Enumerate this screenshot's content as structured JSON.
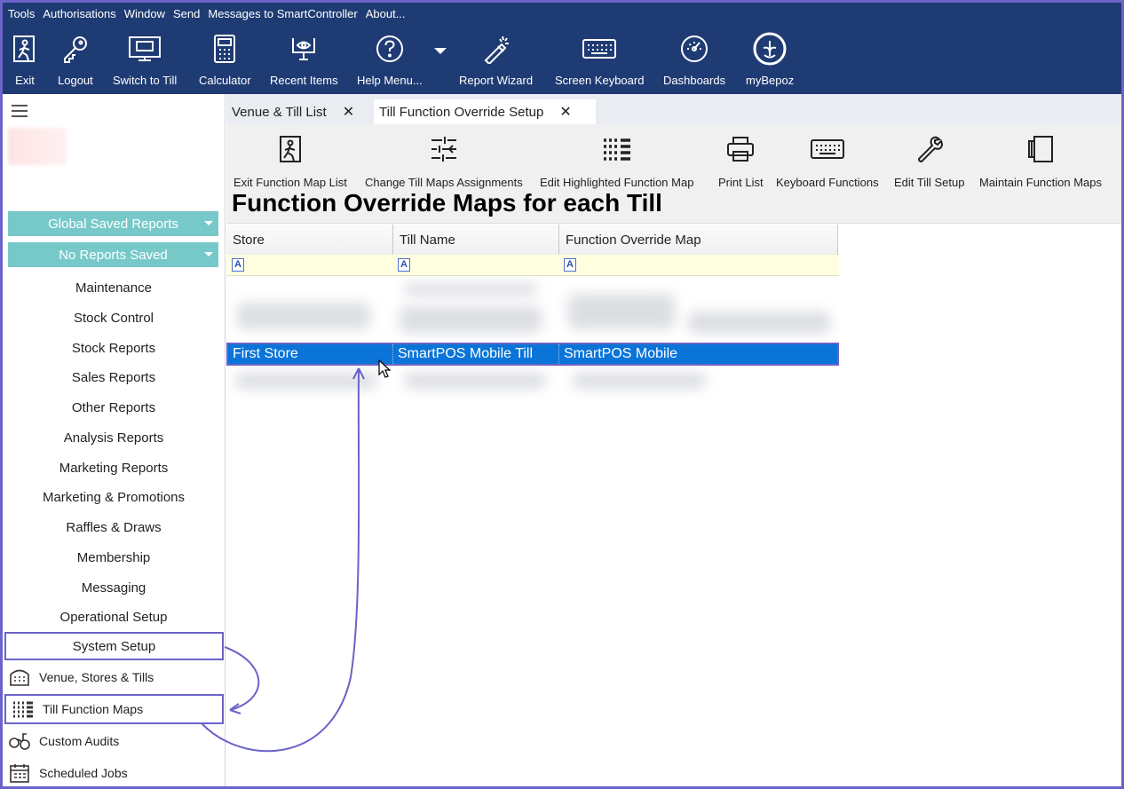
{
  "menubar": [
    "Tools",
    "Authorisations",
    "Window",
    "Send",
    "Messages to SmartController",
    "About..."
  ],
  "ribbon": [
    {
      "label": "Exit",
      "icon": "exit-icon"
    },
    {
      "label": "Logout",
      "icon": "key-icon"
    },
    {
      "label": "Switch to Till",
      "icon": "till-icon"
    },
    {
      "label": "Calculator",
      "icon": "calculator-icon"
    },
    {
      "label": "Recent Items",
      "icon": "recent-items-icon"
    },
    {
      "label": "Help Menu...",
      "icon": "help-icon"
    },
    {
      "label": "Report Wizard",
      "icon": "wizard-icon"
    },
    {
      "label": "Screen Keyboard",
      "icon": "keyboard-icon"
    },
    {
      "label": "Dashboards",
      "icon": "dashboard-icon"
    },
    {
      "label": "myBepoz",
      "icon": "mybepoz-icon"
    }
  ],
  "sidebar": {
    "global_saved_reports": "Global Saved Reports",
    "no_reports_saved": "No Reports Saved",
    "items": [
      "Maintenance",
      "Stock Control",
      "Stock Reports",
      "Sales Reports",
      "Other Reports",
      "Analysis Reports",
      "Marketing Reports",
      "Marketing & Promotions",
      "Raffles & Draws",
      "Membership",
      "Messaging",
      "Operational Setup",
      "System Setup"
    ],
    "subitems": [
      {
        "label": "Venue, Stores & Tills",
        "icon": "venue-icon"
      },
      {
        "label": "Till Function Maps",
        "icon": "function-map-icon"
      },
      {
        "label": "Custom Audits",
        "icon": "audit-icon"
      },
      {
        "label": "Scheduled Jobs",
        "icon": "calendar-icon"
      }
    ]
  },
  "tabs": [
    {
      "label": "Venue & Till List",
      "close": "✕"
    },
    {
      "label": "Till Function Override Setup",
      "close": "✕"
    }
  ],
  "toolbar": [
    {
      "label": "Exit Function Map List",
      "icon": "exit-icon"
    },
    {
      "label": "Change Till Maps Assignments",
      "icon": "assign-icon"
    },
    {
      "label": "Edit Highlighted Function Map",
      "icon": "function-map-icon"
    },
    {
      "label": "Print List",
      "icon": "print-icon"
    },
    {
      "label": "Keyboard Functions",
      "icon": "keyboard-icon"
    },
    {
      "label": "Edit Till Setup",
      "icon": "wrench-icon"
    },
    {
      "label": "Maintain Function Maps",
      "icon": "maintain-icon"
    }
  ],
  "page_title": "Function Override Maps for each Till",
  "grid": {
    "columns": [
      "Store",
      "Till Name",
      "Function Override Map"
    ],
    "filter_glyph": "A",
    "selected_row": [
      "First Store",
      "SmartPOS Mobile Till",
      "SmartPOS Mobile"
    ]
  },
  "colors": {
    "header": "#1f3b73",
    "accent": "#6b63c9",
    "dropdown": "#77c9c9",
    "selection": "#0a74d8"
  }
}
